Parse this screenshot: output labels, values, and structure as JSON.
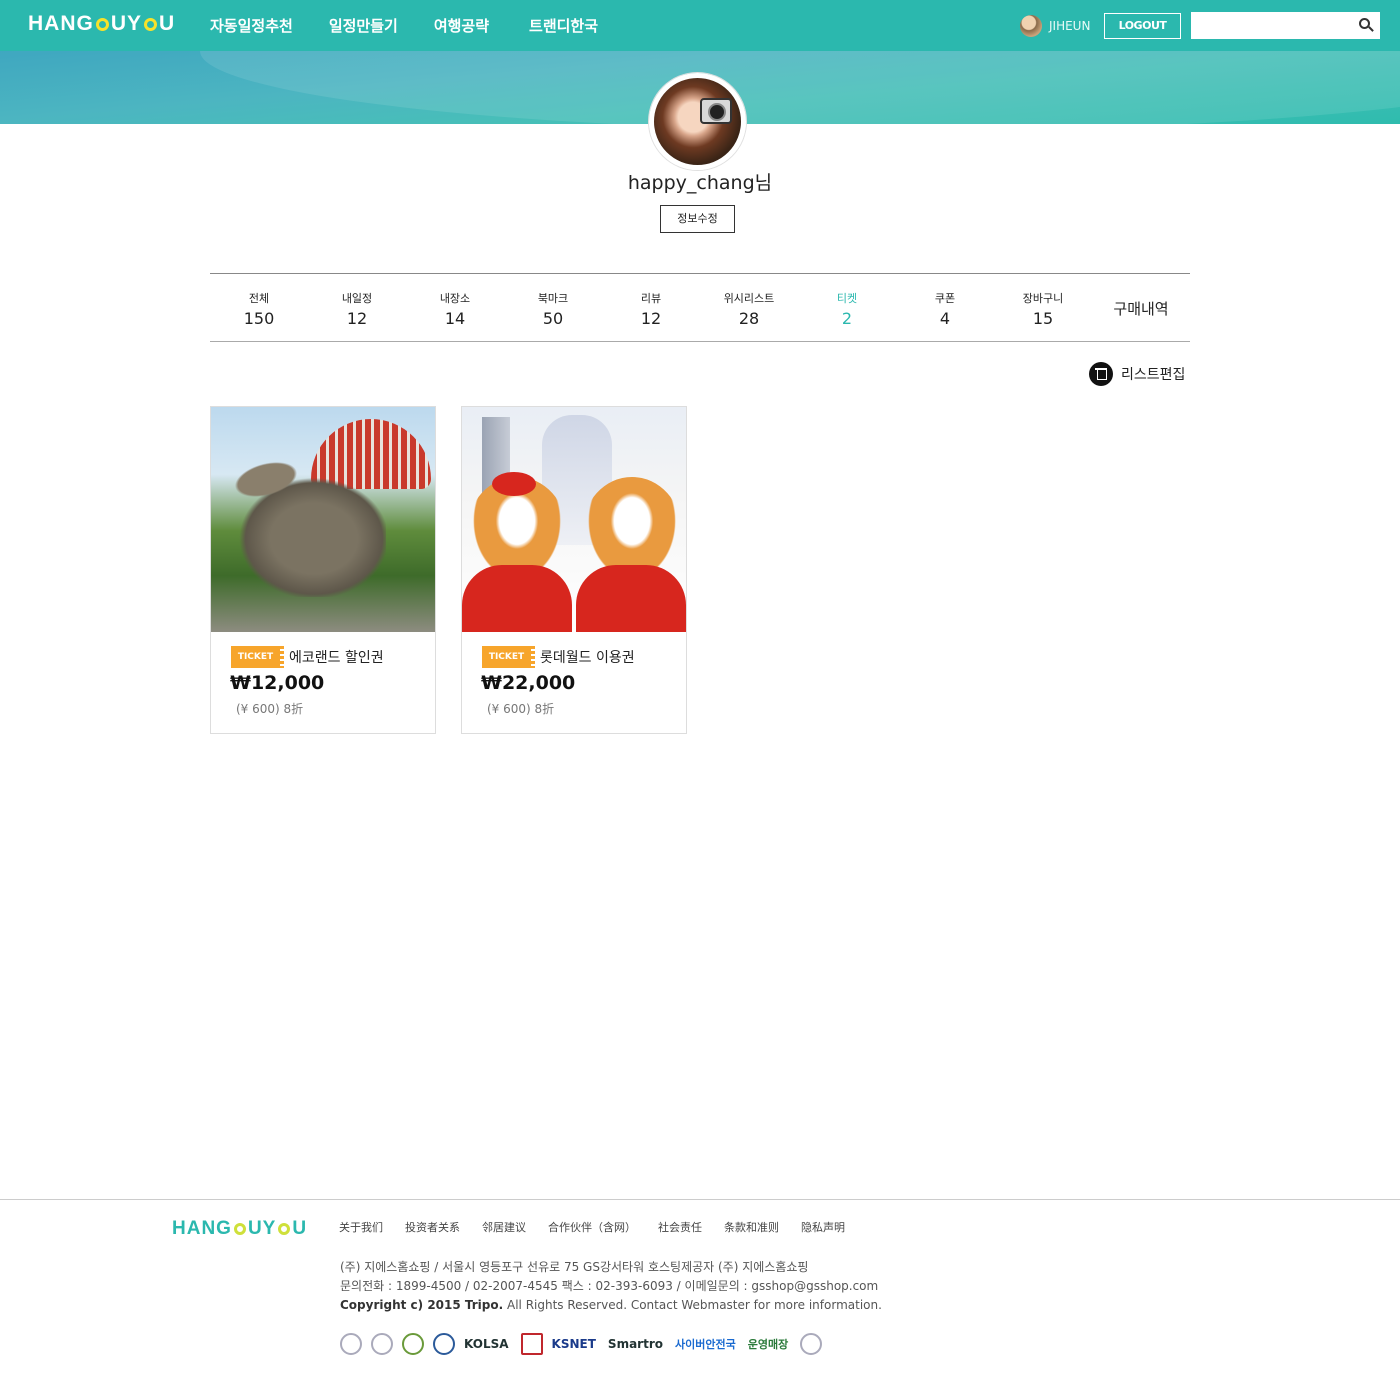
{
  "header": {
    "logo_a": "HANG",
    "logo_b": "UY",
    "nav": [
      "자동일정추천",
      "일정만들기",
      "여행공략",
      "트랜디한국"
    ],
    "user_name": "JIHEUN",
    "logout_label": "LOGOUT",
    "search_placeholder": ""
  },
  "profile": {
    "name": "happy_chang님",
    "edit_label": "정보수정"
  },
  "tabs": [
    {
      "label": "전체",
      "count": "150"
    },
    {
      "label": "내일정",
      "count": "12"
    },
    {
      "label": "내장소",
      "count": "14"
    },
    {
      "label": "북마크",
      "count": "50"
    },
    {
      "label": "리뷰",
      "count": "12"
    },
    {
      "label": "위시리스트",
      "count": "28"
    },
    {
      "label": "티켓",
      "count": "2"
    },
    {
      "label": "쿠폰",
      "count": "4"
    },
    {
      "label": "장바구니",
      "count": "15"
    },
    {
      "label": "구매내역",
      "count": ""
    }
  ],
  "active_tab": "티켓",
  "list_edit_label": "리스트편집",
  "cards": [
    {
      "tag": "TICKET",
      "title": "에코랜드 할인권",
      "price": "₩12,000",
      "sub": "(¥ 600) 8折"
    },
    {
      "tag": "TICKET",
      "title": "롯데월드 이용권",
      "price": "₩22,000",
      "sub": "(¥ 600) 8折"
    }
  ],
  "footer": {
    "logo_a": "HANG",
    "logo_b": "UY",
    "links": [
      "关于我们",
      "投资者关系",
      "邻居建议",
      "合作伙伴（含网）",
      "社会责任",
      "条款和准则",
      "隐私声明"
    ],
    "line1": "(주) 지에스홈쇼핑  / 서울시 영등포구 선유로 75 GS강서타워 호스팅제공자 (주) 지에스홈쇼핑",
    "line2": "문의전화 : 1899-4500 / 02-2007-4545 팩스 : 02-393-6093 / 이메일문의 : gsshop@gsshop.com",
    "copyright_bold": "Copyright c) 2015 Tripo.",
    "copyright_rest": " All Rights Reserved. Contact Webmaster for more information.",
    "badge_texts": [
      "KOLSA",
      "KSNET",
      "Smartro",
      "사이버안전국",
      "운영매장"
    ]
  },
  "colors": {
    "brand": "#2bb8ae",
    "ticket_tag": "#f7a52b"
  }
}
